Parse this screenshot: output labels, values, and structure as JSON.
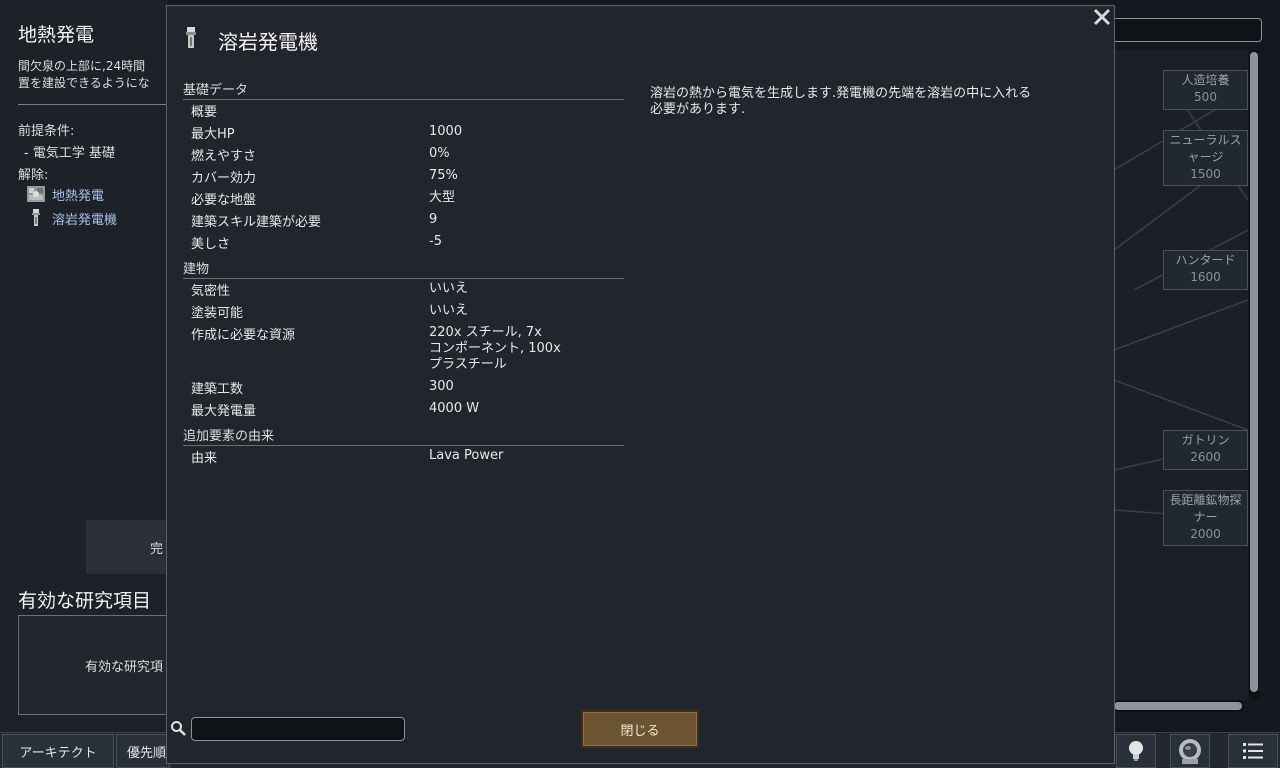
{
  "background": {
    "project_title": "地熱発電",
    "description_lines": [
      "間欠泉の上部に,24時間",
      "置を建設できるようにな"
    ],
    "prerequisites_label": "前提条件:",
    "prerequisite_item": " - 電気工学 基礎",
    "unlocks_label": "解除:",
    "unlocks": [
      {
        "label": "地熱発電",
        "icon": "geothermal-icon"
      },
      {
        "label": "溶岩発電機",
        "icon": "lava-generator-icon"
      }
    ],
    "complete_button_label": "完",
    "active_research_title": "有効な研究項目",
    "active_research_text": "有効な研究項"
  },
  "tree_nodes": [
    {
      "name": "人造培養",
      "cost": "500"
    },
    {
      "name": "ニューラルス",
      "name2": "ャージ",
      "cost": "1500"
    },
    {
      "name": "ハンタード",
      "cost": "1600"
    },
    {
      "name": "ガトリン",
      "cost": "2600"
    },
    {
      "name": "長距離鉱物探",
      "name2": "ナー",
      "cost": "2000"
    }
  ],
  "taskbar": {
    "buttons": [
      "アーキテクト",
      "優先順"
    ],
    "icons": [
      "lightbulb-icon",
      "astronaut-icon",
      "list-menu-icon"
    ]
  },
  "dialog": {
    "title": "溶岩発電機",
    "sections": {
      "basic": "基礎データ",
      "building": "建物",
      "source": "追加要素の由来"
    },
    "basic_rows": [
      {
        "label": "概要",
        "value": ""
      },
      {
        "label": "最大HP",
        "value": "1000"
      },
      {
        "label": "燃えやすさ",
        "value": "0%"
      },
      {
        "label": "カバー効力",
        "value": "75%"
      },
      {
        "label": "必要な地盤",
        "value": "大型"
      },
      {
        "label": "建築スキル建築が必要",
        "value": "9"
      },
      {
        "label": "美しさ",
        "value": "-5"
      }
    ],
    "building_rows": [
      {
        "label": "気密性",
        "value": "いいえ"
      },
      {
        "label": "塗装可能",
        "value": "いいえ"
      },
      {
        "label": "作成に必要な資源",
        "value_lines": [
          "220x スチール, 7x",
          "コンポーネント, 100x",
          "プラスチール"
        ]
      },
      {
        "label": "建築工数",
        "value": "300"
      },
      {
        "label": "最大発電量",
        "value": "4000 W"
      }
    ],
    "source_rows": [
      {
        "label": "由来",
        "value": "Lava Power"
      }
    ],
    "description": "溶岩の熱から電気を生成します.発電機の先端を溶岩の中に入れる\n必要があります.",
    "search_value": "",
    "close_button_label": "閉じる"
  }
}
